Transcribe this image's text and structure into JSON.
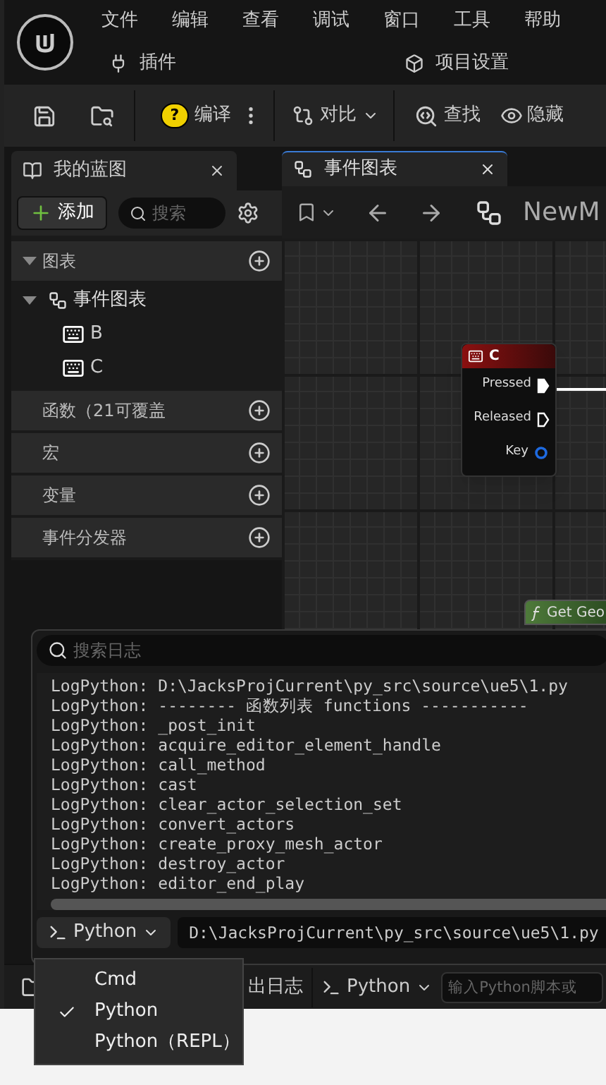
{
  "menu": [
    "文件",
    "编辑",
    "查看",
    "调试",
    "窗口",
    "工具",
    "帮助"
  ],
  "menu_row2": [
    {
      "kind": "plugins",
      "label": "插件"
    },
    {
      "kind": "settings",
      "label": "项目设置"
    }
  ],
  "toolbar": {
    "compile_badge": "?",
    "compile": "编译",
    "diff": "对比",
    "find": "查找",
    "hide": "隐藏"
  },
  "my_blueprint": {
    "title": "我的蓝图",
    "add": "添加",
    "search_placeholder": "搜索",
    "sections": [
      {
        "label": "图表",
        "expanded": true,
        "children": [
          {
            "label": "事件图表",
            "expanded": true,
            "children": [
              {
                "label": "B"
              },
              {
                "label": "C"
              }
            ]
          }
        ]
      },
      {
        "label": "函数（21可覆盖",
        "expanded": false
      },
      {
        "label": "宏",
        "expanded": false
      },
      {
        "label": "变量",
        "expanded": false
      },
      {
        "label": "事件分发器",
        "expanded": false
      }
    ]
  },
  "graph": {
    "tab": "事件图表",
    "breadcrumb": "NewM",
    "nodes": [
      {
        "kind": "event",
        "title": "C",
        "pins": [
          {
            "label": "Pressed",
            "kind": "exec",
            "connected": true
          },
          {
            "label": "Released",
            "kind": "exec",
            "connected": false
          },
          {
            "label": "Key",
            "kind": "data",
            "connected": false
          }
        ]
      },
      {
        "kind": "function",
        "title": "Get Geo"
      }
    ]
  },
  "output_log": {
    "search_placeholder": "搜索日志",
    "lines": [
      "LogPython: D:\\JacksProjCurrent\\py_src\\source\\ue5\\1.py",
      "LogPython: -------- 函数列表 functions -----------",
      "LogPython: _post_init",
      "LogPython: acquire_editor_element_handle",
      "LogPython: call_method",
      "LogPython: cast",
      "LogPython: clear_actor_selection_set",
      "LogPython: convert_actors",
      "LogPython: create_proxy_mesh_actor",
      "LogPython: destroy_actor",
      "LogPython: editor_end_play"
    ],
    "command_type": "Python",
    "command_value": "D:\\JacksProjCurrent\\py_src\\source\\ue5\\1.py"
  },
  "status_bar": {
    "output_log": "出日志",
    "command_type": "Python",
    "command_placeholder": "输入Python脚本或"
  },
  "command_menu": [
    {
      "label": "Cmd",
      "selected": false
    },
    {
      "label": "Python",
      "selected": true
    },
    {
      "label": "Python（REPL）",
      "selected": false
    }
  ]
}
